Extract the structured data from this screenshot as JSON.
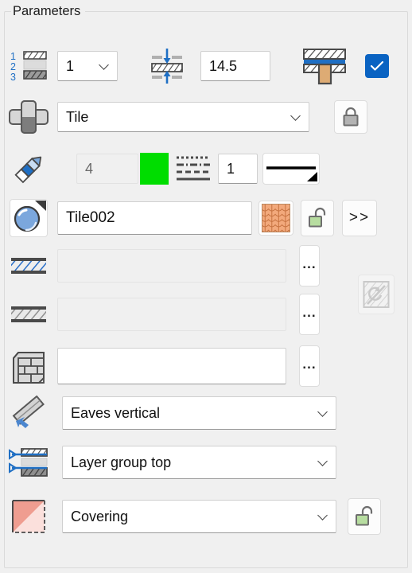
{
  "panel": {
    "title": "Parameters"
  },
  "rows": {
    "layer_index": {
      "icon": "numbered-layers-icon",
      "value": "1",
      "thickness_icon": "layer-thickness-icon",
      "thickness_value": "14.5",
      "core_icon": "core-layer-icon",
      "checkbox_checked": true,
      "checkbox_glyph": "check-icon"
    },
    "component": {
      "icon": "component-cross-icon",
      "value": "Tile",
      "lock_icon": "lock-closed-icon",
      "lock_state": "locked"
    },
    "pen": {
      "icon": "pen-icon",
      "pen_number": "4",
      "color_swatch": "#00dd00",
      "linetype_icon": "linetype-icon",
      "linetype_value": "1",
      "lineweight_preview": "line-weight-preview"
    },
    "material": {
      "icon": "material-sphere-icon",
      "value": "Tile002",
      "texture_icon": "roof-tile-texture-icon",
      "lock_icon": "lock-open-icon",
      "lock_state": "unlocked",
      "expand_label": ">>"
    },
    "fill_cut": {
      "icon": "blue-hatch-icon",
      "value": "",
      "browse_label": "...",
      "side_button_icon": "hatch-disabled-icon",
      "side_button_enabled": false
    },
    "fill_surface": {
      "icon": "gray-hatch-icon",
      "value": "",
      "browse_label": "..."
    },
    "building_material": {
      "icon": "brick-wall-icon",
      "value": "",
      "browse_label": "..."
    },
    "reference_line": {
      "icon": "eaves-arrow-icon",
      "value": "Eaves vertical"
    },
    "layer_position": {
      "icon": "layer-group-icon",
      "value": "Layer group top"
    },
    "classification": {
      "icon": "covering-swatch-icon",
      "value": "Covering",
      "lock_icon": "lock-open-icon",
      "lock_state": "unlocked"
    }
  },
  "colors": {
    "panel_bg": "#f0f0f0",
    "accent_blue": "#1f6fc4",
    "checkbox_blue": "#0a63c2",
    "pen_color": "#00dd00",
    "texture_orange": "#f0a878",
    "unlock_green": "#b7dda0",
    "covering_red": "#f0a094"
  }
}
